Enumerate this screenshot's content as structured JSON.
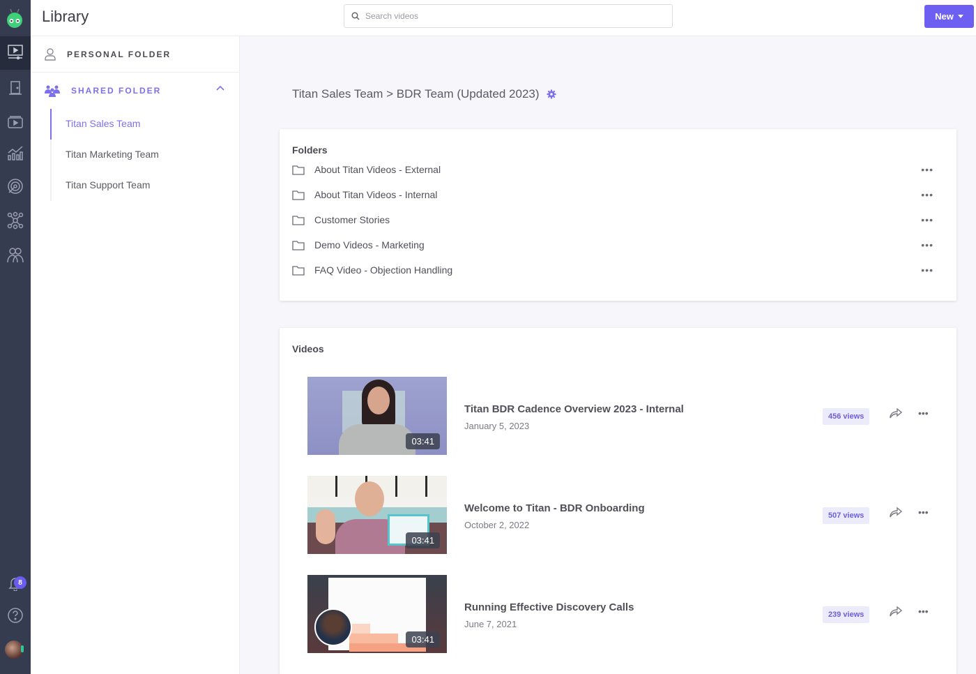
{
  "app": {
    "title": "Library"
  },
  "search": {
    "placeholder": "Search videos"
  },
  "new_button": {
    "label": "New"
  },
  "notifications": {
    "count": "8"
  },
  "sidebar": {
    "personal": {
      "label": "PERSONAL FOLDER"
    },
    "shared": {
      "label": "SHARED FOLDER",
      "items": [
        {
          "label": "Titan Sales Team",
          "active": true
        },
        {
          "label": "Titan Marketing Team"
        },
        {
          "label": "Titan Support Team"
        }
      ]
    }
  },
  "breadcrumb": {
    "path": "Titan Sales Team > BDR Team (Updated 2023)"
  },
  "folders": {
    "heading": "Folders",
    "items": [
      {
        "name": "About Titan Videos - External"
      },
      {
        "name": "About Titan Videos - Internal"
      },
      {
        "name": "Customer Stories"
      },
      {
        "name": "Demo Videos - Marketing"
      },
      {
        "name": "FAQ Video - Objection Handling"
      }
    ],
    "more": "•••"
  },
  "videos": {
    "heading": "Videos",
    "items": [
      {
        "title": "Titan BDR Cadence Overview 2023 - Internal",
        "date": "January 5, 2023",
        "views": "456 views",
        "duration": "03:41"
      },
      {
        "title": "Welcome to Titan - BDR Onboarding",
        "date": "October 2, 2022",
        "views": "507 views",
        "duration": "03:41"
      },
      {
        "title": "Running Effective Discovery Calls",
        "date": "June 7, 2021",
        "views": "239 views",
        "duration": "03:41"
      }
    ],
    "more": "•••"
  },
  "colors": {
    "accent": "#6c5ff2",
    "rail": "#353c50"
  }
}
